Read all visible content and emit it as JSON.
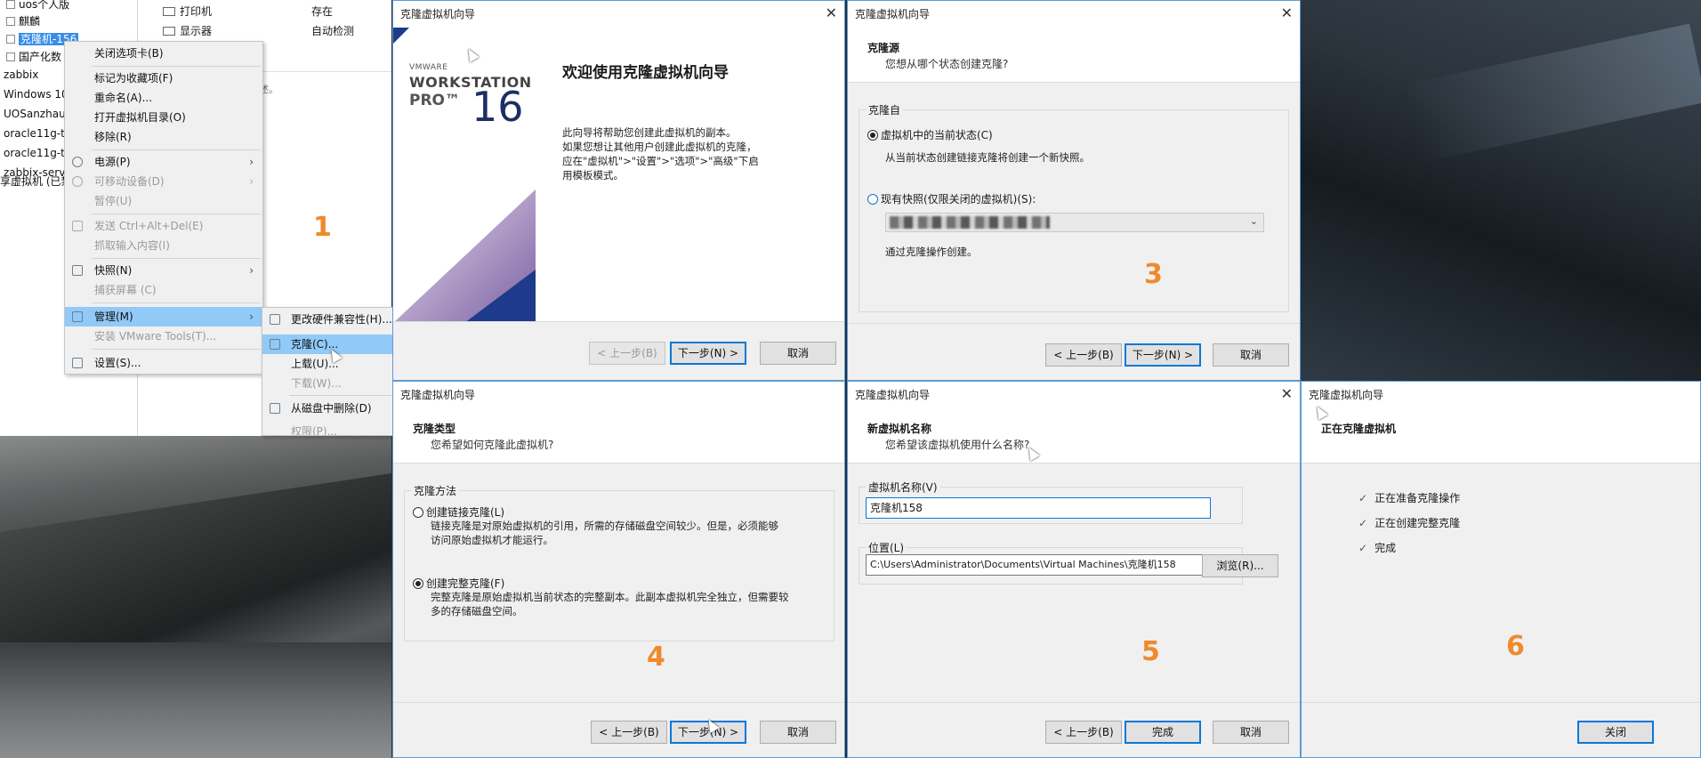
{
  "library": {
    "items": [
      {
        "label": "uos个人版",
        "selected": false,
        "checkbox": true
      },
      {
        "label": "麒麟",
        "selected": false,
        "checkbox": true
      },
      {
        "label": "克隆机-156",
        "selected": true,
        "checkbox": true
      },
      {
        "label": "国产化数",
        "selected": false,
        "checkbox": true
      },
      {
        "label": "zabbix",
        "selected": false,
        "checkbox": false
      },
      {
        "label": "Windows 10",
        "selected": false,
        "checkbox": false
      },
      {
        "label": "UOSanzhau",
        "selected": false,
        "checkbox": false
      },
      {
        "label": "oracle11g-t",
        "selected": false,
        "checkbox": false
      },
      {
        "label": "oracle11g-t",
        "selected": false,
        "checkbox": false
      },
      {
        "label": "zabbix-serv",
        "selected": false,
        "checkbox": false
      },
      {
        "label": "享虚拟机 (已禁",
        "selected": false,
        "checkbox": false
      }
    ]
  },
  "devices": {
    "printer": {
      "label": "打印机",
      "value": "存在"
    },
    "display": {
      "label": "显示器",
      "value": "自动检测"
    },
    "description_hint": "描述。"
  },
  "context_menu": {
    "close_tab": "关闭选项卡(B)",
    "favorite": "标记为收藏项(F)",
    "rename": "重命名(A)...",
    "open_dir": "打开虚拟机目录(O)",
    "remove": "移除(R)",
    "power": "电源(P)",
    "removable": "可移动设备(D)",
    "pause": "暂停(U)",
    "send_cad": "发送 Ctrl+Alt+Del(E)",
    "grab_input": "抓取输入内容(I)",
    "snapshot": "快照(N)",
    "capture_screen": "捕获屏幕 (C)",
    "manage": "管理(M)",
    "install_tools": "安装 VMware Tools(T)...",
    "settings": "设置(S)..."
  },
  "submenu": {
    "hw_compat": "更改硬件兼容性(H)...",
    "clone": "克隆(C)...",
    "upload": "上载(U)...",
    "download": "下载(W)...",
    "delete_disk": "从磁盘中删除(D)",
    "permissions": "权限(P)..."
  },
  "steps": [
    "1",
    "2",
    "3",
    "4",
    "5",
    "6"
  ],
  "wizard_title": "克隆虚拟机向导",
  "buttons": {
    "back": "< 上一步(B)",
    "next": "下一步(N) >",
    "cancel": "取消",
    "finish": "完成",
    "close": "关闭",
    "browse": "浏览(R)..."
  },
  "welcome": {
    "heading": "欢迎使用克隆虚拟机向导",
    "body": [
      "此向导将帮助您创建此虚拟机的副本。",
      "如果您想让其他用户创建此虚拟机的克隆，",
      "应在\"虚拟机\">\"设置\">\"选项\">\"高级\"下启",
      "用模板模式。"
    ],
    "brand_small": "VMWARE",
    "brand_product": "WORKSTATION",
    "brand_edition": "PRO™",
    "brand_version": "16"
  },
  "clone_source": {
    "heading": "克隆源",
    "subheading": "您想从哪个状态创建克隆?",
    "group": "克隆自",
    "opt_current": "虚拟机中的当前状态(C)",
    "opt_current_note": "从当前状态创建链接克隆将创建一个新快照。",
    "opt_snapshot": "现有快照(仅限关闭的虚拟机)(S):",
    "snapshot_note": "通过克隆操作创建。"
  },
  "clone_type": {
    "heading": "克隆类型",
    "subheading": "您希望如何克隆此虚拟机?",
    "group": "克隆方法",
    "opt_linked": "创建链接克隆(L)",
    "opt_linked_note": [
      "链接克隆是对原始虚拟机的引用，所需的存储磁盘空间较少。但是，必须能够",
      "访问原始虚拟机才能运行。"
    ],
    "opt_full": "创建完整克隆(F)",
    "opt_full_note": [
      "完整克隆是原始虚拟机当前状态的完整副本。此副本虚拟机完全独立，但需要较",
      "多的存储磁盘空间。"
    ]
  },
  "vm_name": {
    "heading": "新虚拟机名称",
    "subheading": "您希望该虚拟机使用什么名称?",
    "name_label": "虚拟机名称(V)",
    "name_value": "克隆机158",
    "location_label": "位置(L)",
    "location_value": "C:\\Users\\Administrator\\Documents\\Virtual Machines\\克隆机158"
  },
  "cloning": {
    "heading": "正在克隆虚拟机",
    "tasks": [
      "正在准备克隆操作",
      "正在创建完整克隆",
      "完成"
    ]
  },
  "colors": {
    "step_number": "#f08a2c",
    "accent": "#0a78d7",
    "highlight": "#91c9f7"
  }
}
